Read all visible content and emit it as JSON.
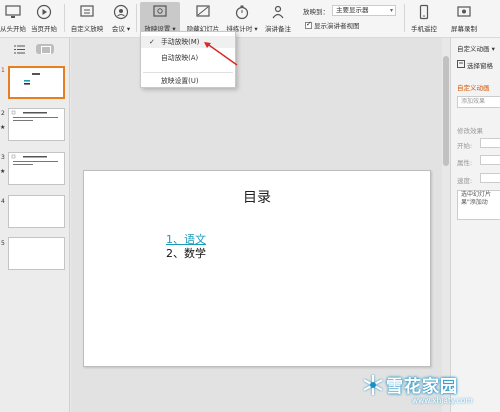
{
  "ribbon": {
    "buttons": [
      {
        "label": "从头开始",
        "icon": "monitor-icon"
      },
      {
        "label": "当页开始",
        "icon": "play-icon"
      },
      {
        "label": "自定义放映",
        "icon": "custom-show-icon"
      },
      {
        "label": "会议 ▾",
        "icon": "meeting-icon"
      },
      {
        "label": "放映设置 ▾",
        "icon": "slideshow-settings-icon"
      },
      {
        "label": "隐藏幻灯片",
        "icon": "hide-slide-icon"
      },
      {
        "label": "排练计时 ▾",
        "icon": "timer-icon"
      },
      {
        "label": "演讲备注",
        "icon": "speaker-notes-icon"
      },
      {
        "label": "手机遥控",
        "icon": "phone-remote-icon"
      },
      {
        "label": "屏幕录制",
        "icon": "screen-record-icon"
      }
    ],
    "show_on_label": "放映到：",
    "show_on_value": "主要显示器",
    "presenter_view_label": "显示演讲者视图"
  },
  "dropdown": {
    "items": [
      {
        "label": "手动放映(M)",
        "checked": true
      },
      {
        "label": "自动放映(A)",
        "checked": false
      },
      {
        "label": "放映设置(U)",
        "checked": false
      }
    ]
  },
  "thumbnails": [
    {
      "num": "1",
      "current": true,
      "star": ""
    },
    {
      "num": "2",
      "current": false,
      "star": "★"
    },
    {
      "num": "3",
      "current": false,
      "star": "★"
    },
    {
      "num": "4",
      "current": false,
      "star": ""
    },
    {
      "num": "5",
      "current": false,
      "star": ""
    }
  ],
  "slide": {
    "title": "目录",
    "lines": [
      "1、语文",
      "2、数学"
    ]
  },
  "right_pane": {
    "header": "自定义动画 ▾",
    "select_pane": "选择窗格",
    "section": "自定义动画",
    "add_effect": "添加效果",
    "modify": "修改效果",
    "start": "开始:",
    "property": "属性:",
    "speed": "速度:",
    "hint_line1": "选中幻灯片",
    "hint_line2": "果\"添加动"
  },
  "watermark": {
    "title": "雪花家园",
    "url": "www.xhjaty.com"
  },
  "colors": {
    "accent_orange": "#e67e22",
    "link_blue": "#1a9bbd",
    "arrow_red": "#d62828"
  }
}
